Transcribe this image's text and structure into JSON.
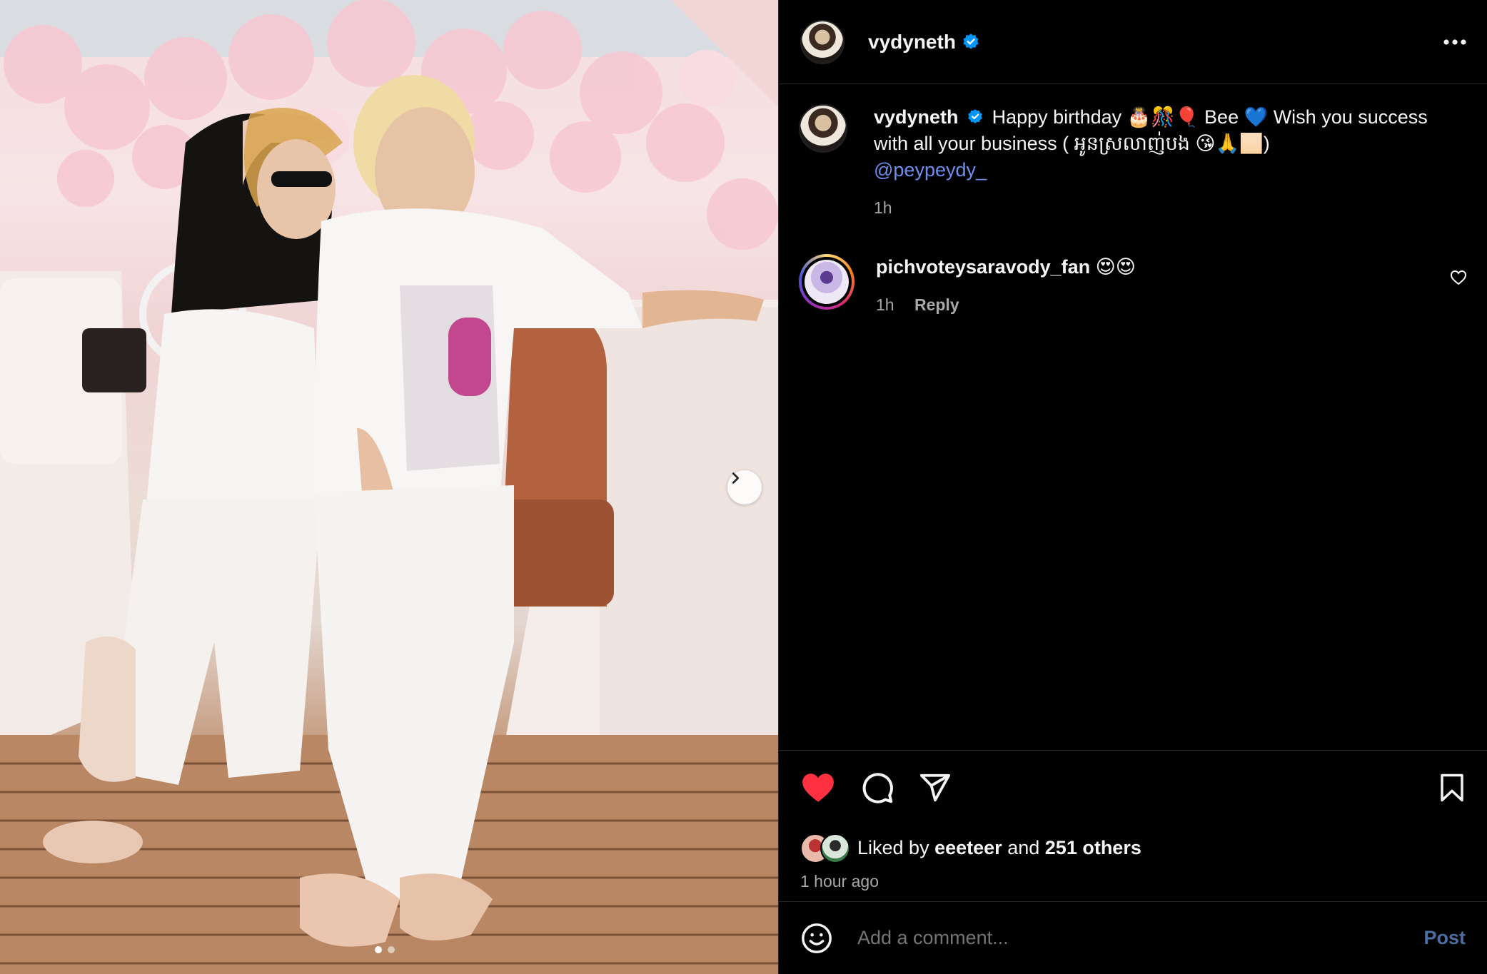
{
  "post": {
    "username": "vydyneth",
    "caption_prefix": "Happy birthday 🎂🎊🎈 Bee 💙 Wish you success with all your business ( អូនស្រលាញ់បង 😘🙏🏻)",
    "caption_mention": "@peypeydy_",
    "caption_time": "1h"
  },
  "comments": [
    {
      "username": "pichvoteysaravody_fan",
      "text": "😍😍",
      "time": "1h",
      "reply_label": "Reply"
    }
  ],
  "likes": {
    "prefix": "Liked by",
    "first_user": "eeeteer",
    "joiner": "and",
    "others": "251 others"
  },
  "timestamp": "1 hour ago",
  "add_comment": {
    "placeholder": "Add a comment...",
    "post_label": "Post"
  },
  "carousel": {
    "current": 1,
    "total": 2
  },
  "colors": {
    "like_red": "#ff3040",
    "mention_blue": "#6e8ff0",
    "verified_blue": "#0095f6",
    "post_blue": "#4b6fa3"
  },
  "icons": [
    "verified-badge-icon",
    "more-icon",
    "heart-filled-icon",
    "comment-icon",
    "share-icon",
    "bookmark-icon",
    "emoji-icon",
    "chevron-right-icon",
    "heart-outline-icon"
  ]
}
